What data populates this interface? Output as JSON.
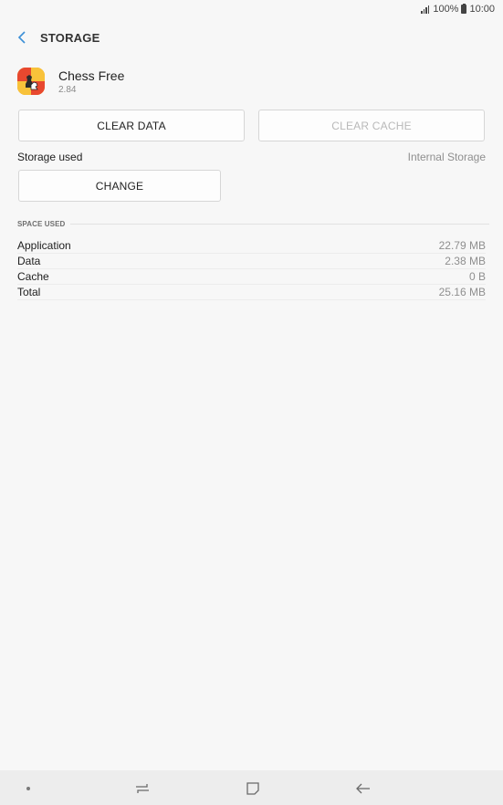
{
  "status_bar": {
    "battery": "100%",
    "time": "10:00"
  },
  "header": {
    "title": "STORAGE",
    "back_icon": "chevron-left-icon"
  },
  "app": {
    "name": "Chess Free",
    "version": "2.84",
    "icon": "chess-app-icon"
  },
  "buttons": {
    "clear_data": "CLEAR DATA",
    "clear_cache": "CLEAR CACHE",
    "change": "CHANGE"
  },
  "storage": {
    "label": "Storage used",
    "value": "Internal Storage"
  },
  "space_used": {
    "heading": "SPACE USED",
    "rows": [
      {
        "label": "Application",
        "value": "22.79 MB"
      },
      {
        "label": "Data",
        "value": "2.38 MB"
      },
      {
        "label": "Cache",
        "value": "0 B"
      },
      {
        "label": "Total",
        "value": "25.16 MB"
      }
    ]
  },
  "colors": {
    "accent": "#3b8fd6",
    "disabled_text": "#b9b9b9",
    "background": "#f7f7f7"
  }
}
